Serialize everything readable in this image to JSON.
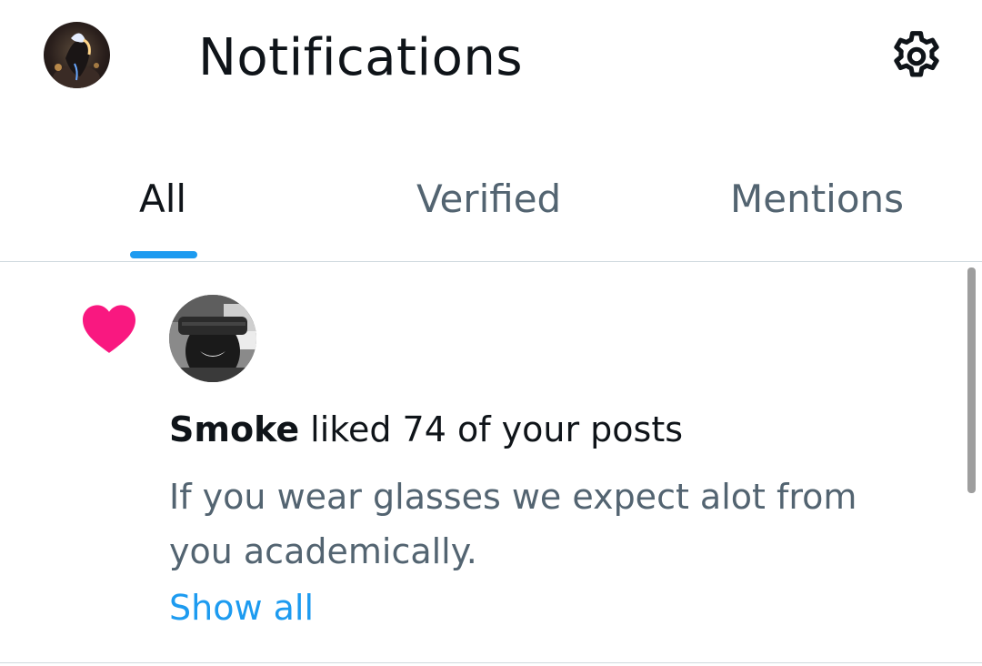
{
  "header": {
    "title": "Notifications",
    "avatar_icon": "profile-avatar",
    "settings_icon": "gear-icon"
  },
  "tabs": [
    {
      "label": "All",
      "active": true
    },
    {
      "label": "Verified",
      "active": false
    },
    {
      "label": "Mentions",
      "active": false
    }
  ],
  "notification": {
    "type_icon": "heart-icon",
    "type_color": "#f91880",
    "user_name": "Smoke",
    "action_text": " liked 74 of your posts",
    "snippet": "If you wear glasses we expect alot from you academically.",
    "show_all_label": "Show all"
  },
  "colors": {
    "accent": "#1d9bf0",
    "primary_text": "#0f1419",
    "secondary_text": "#536471",
    "divider": "#cfd9de"
  }
}
